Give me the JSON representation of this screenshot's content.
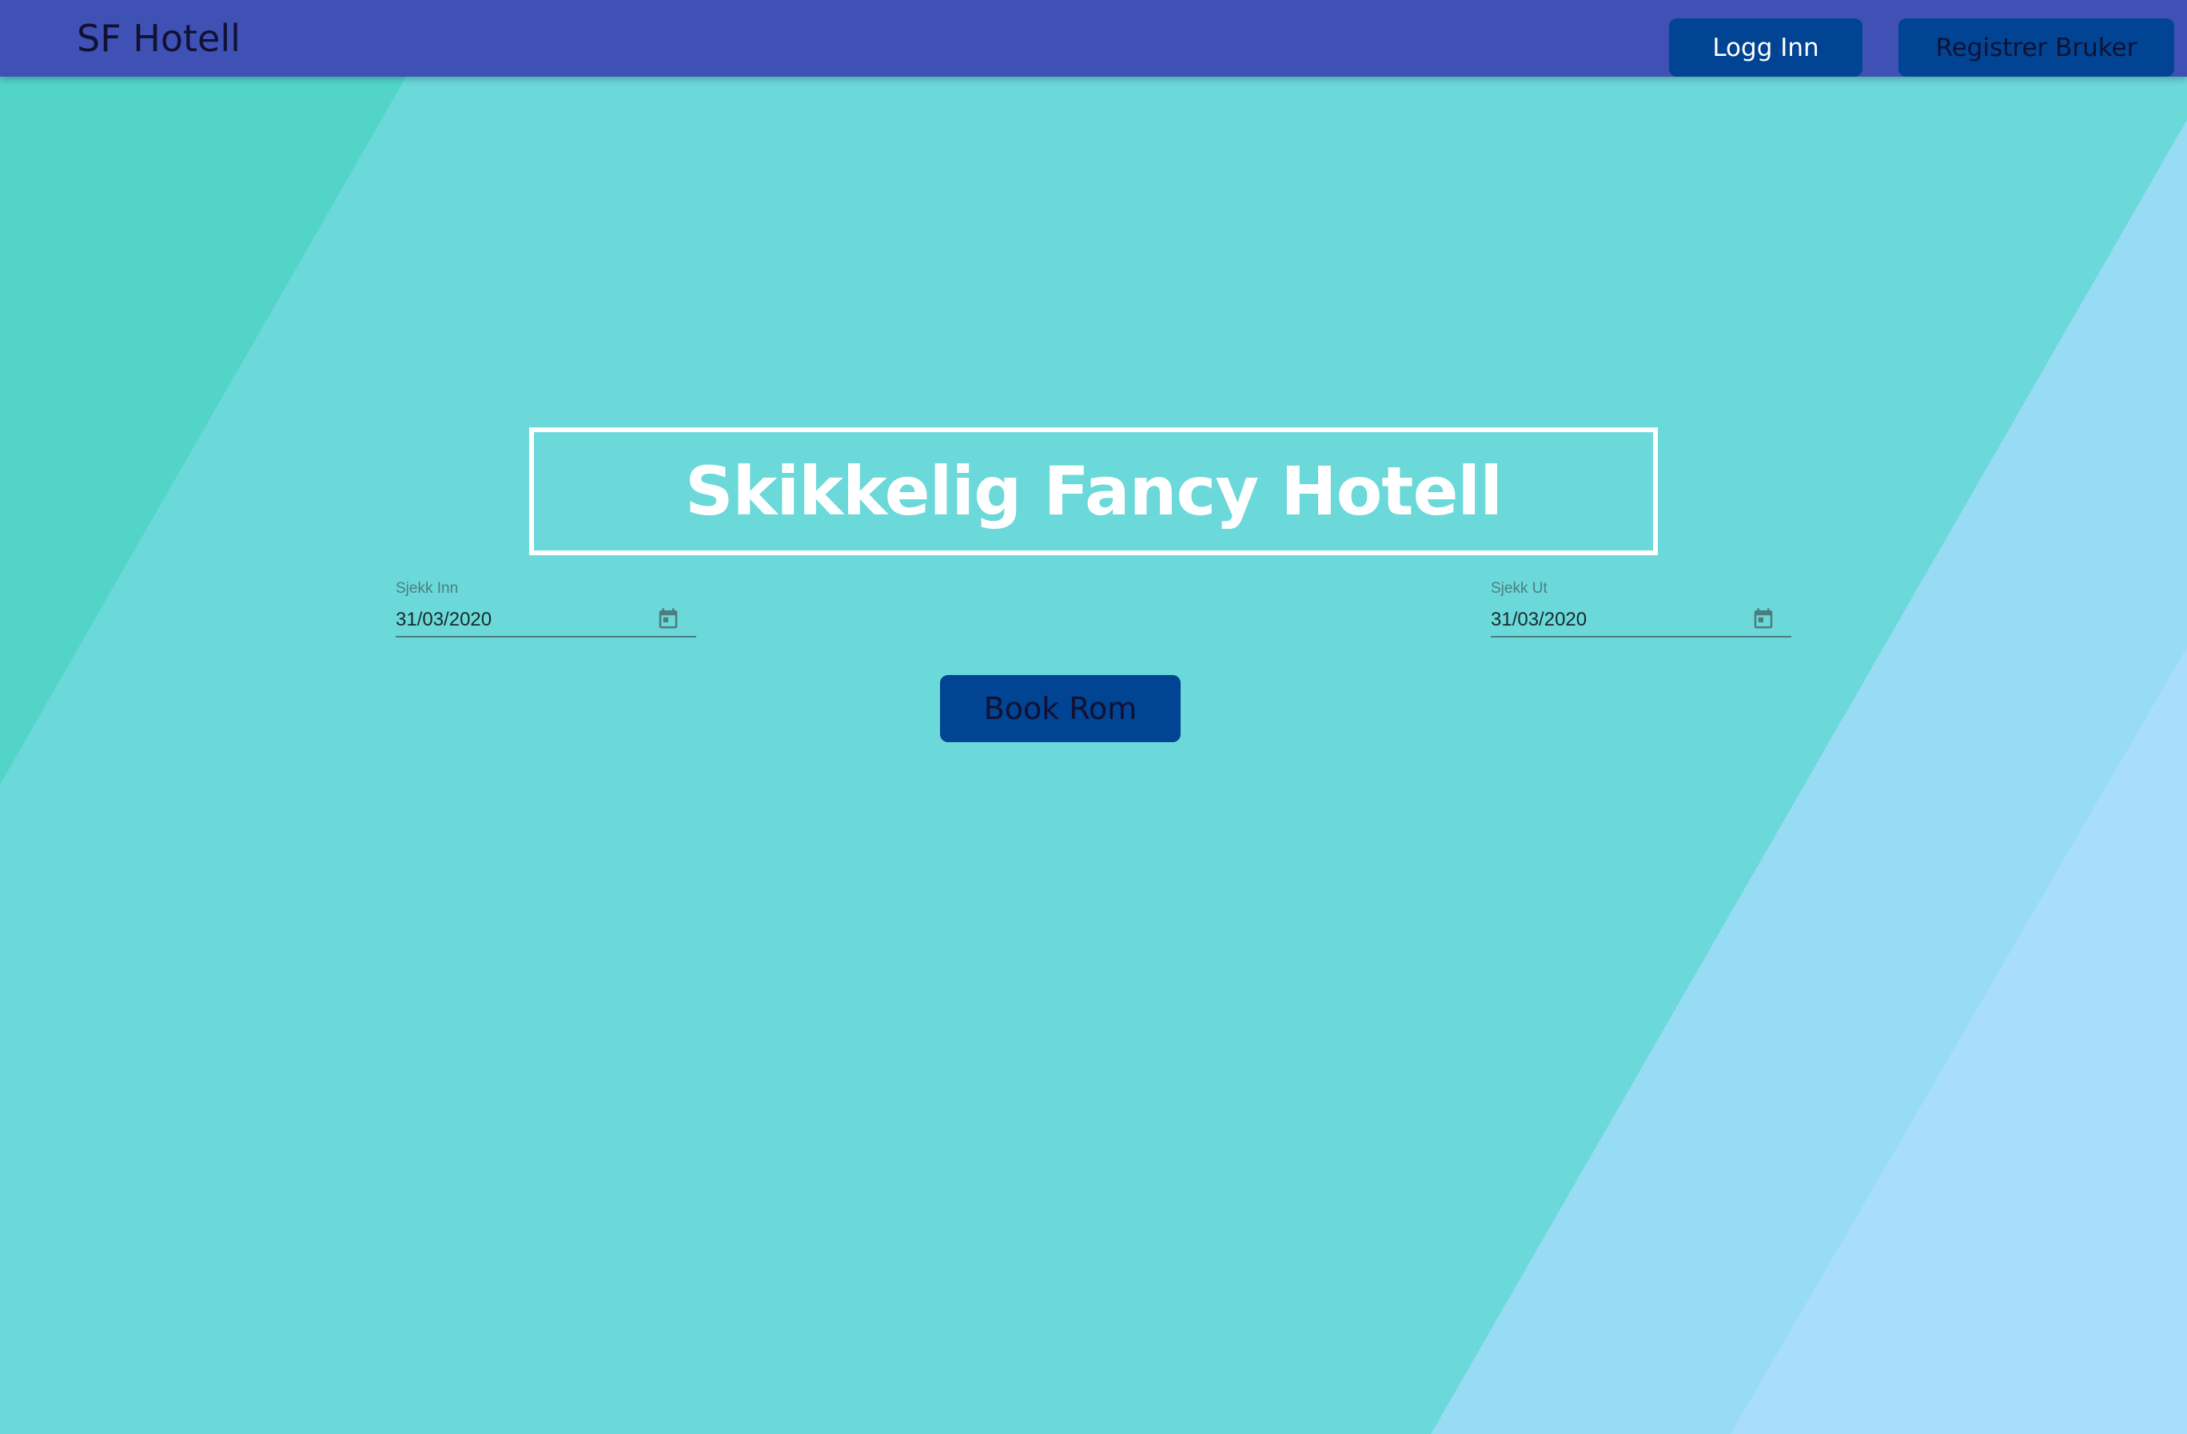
{
  "header": {
    "brand": "SF Hotell",
    "login_label": "Logg Inn",
    "register_label": "Registrer Bruker"
  },
  "hero": {
    "title": "Skikkelig Fancy Hotell"
  },
  "booking": {
    "checkin": {
      "label": "Sjekk Inn",
      "value": "31/03/2020",
      "icon": "calendar-icon"
    },
    "checkout": {
      "label": "Sjekk Ut",
      "value": "31/03/2020",
      "icon": "calendar-icon"
    },
    "book_label": "Book Rom"
  },
  "colors": {
    "navbar": "#3f51b5",
    "button": "#004493",
    "background": "#6bd8d9",
    "left_stripe": "#52d4c9",
    "right_stripe_1": "#98dbf4",
    "right_stripe_2": "#a8defc"
  }
}
